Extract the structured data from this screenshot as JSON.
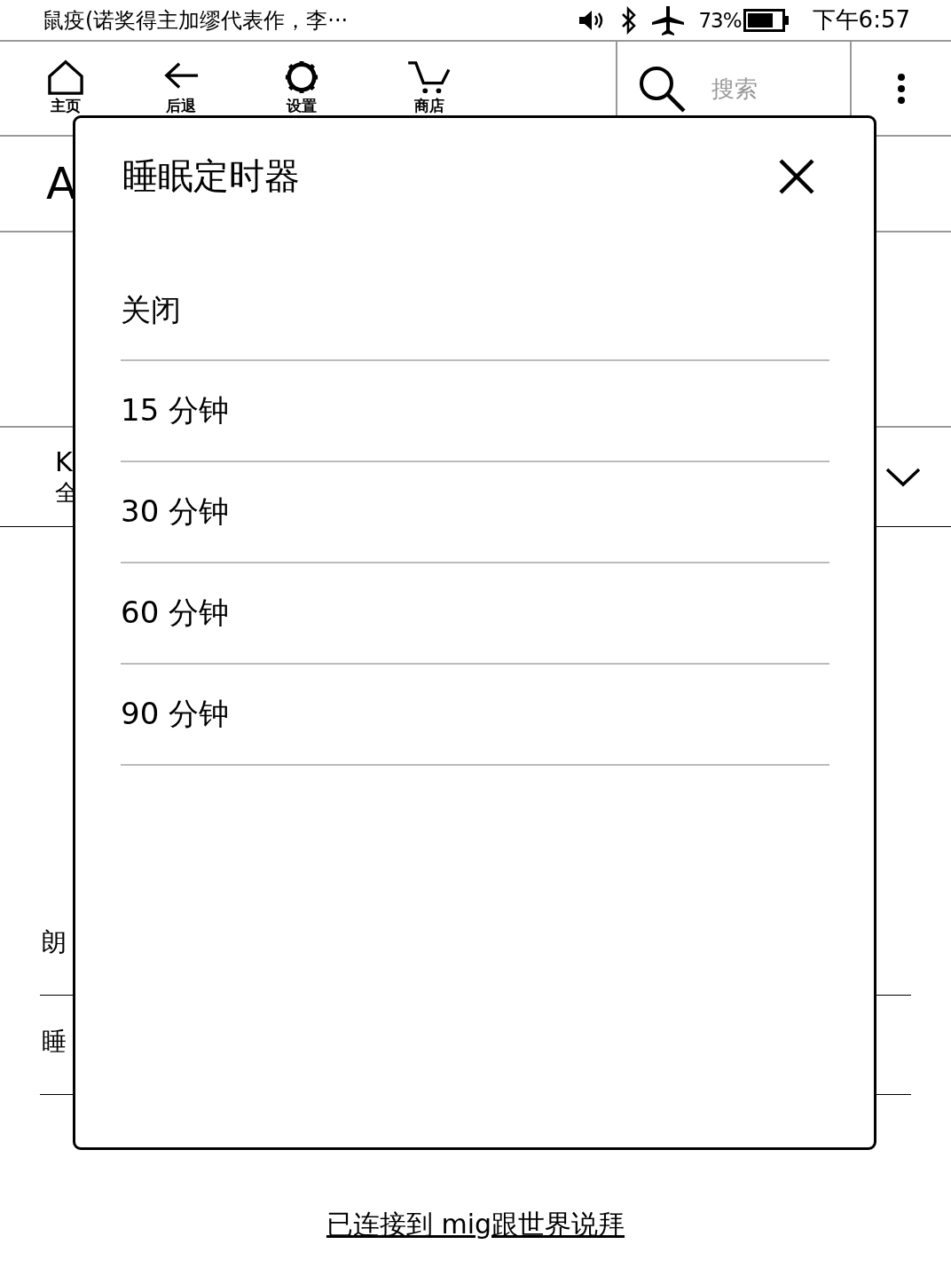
{
  "status_bar": {
    "title": "鼠疫(诺奖得主加缪代表作，李···",
    "battery": "73%",
    "time": "下午6:57"
  },
  "toolbar": {
    "items": [
      {
        "kind": "home",
        "label": "主页"
      },
      {
        "kind": "back",
        "label": "后退"
      },
      {
        "kind": "settings",
        "label": "设置"
      },
      {
        "kind": "store",
        "label": "商店"
      }
    ],
    "search": {
      "placeholder": "搜索"
    }
  },
  "background": {
    "font_row": "A",
    "language_row": [
      "K",
      "全"
    ],
    "read_aloud_row": "朗",
    "sleep_row": "睡"
  },
  "dialog": {
    "title": "睡眠定时器",
    "options": [
      {
        "label": "关闭"
      },
      {
        "label": "15 分钟"
      },
      {
        "label": "30 分钟"
      },
      {
        "label": "60 分钟"
      },
      {
        "label": "90 分钟"
      }
    ]
  },
  "footer": {
    "link": "已连接到 mig跟世界说拜"
  }
}
